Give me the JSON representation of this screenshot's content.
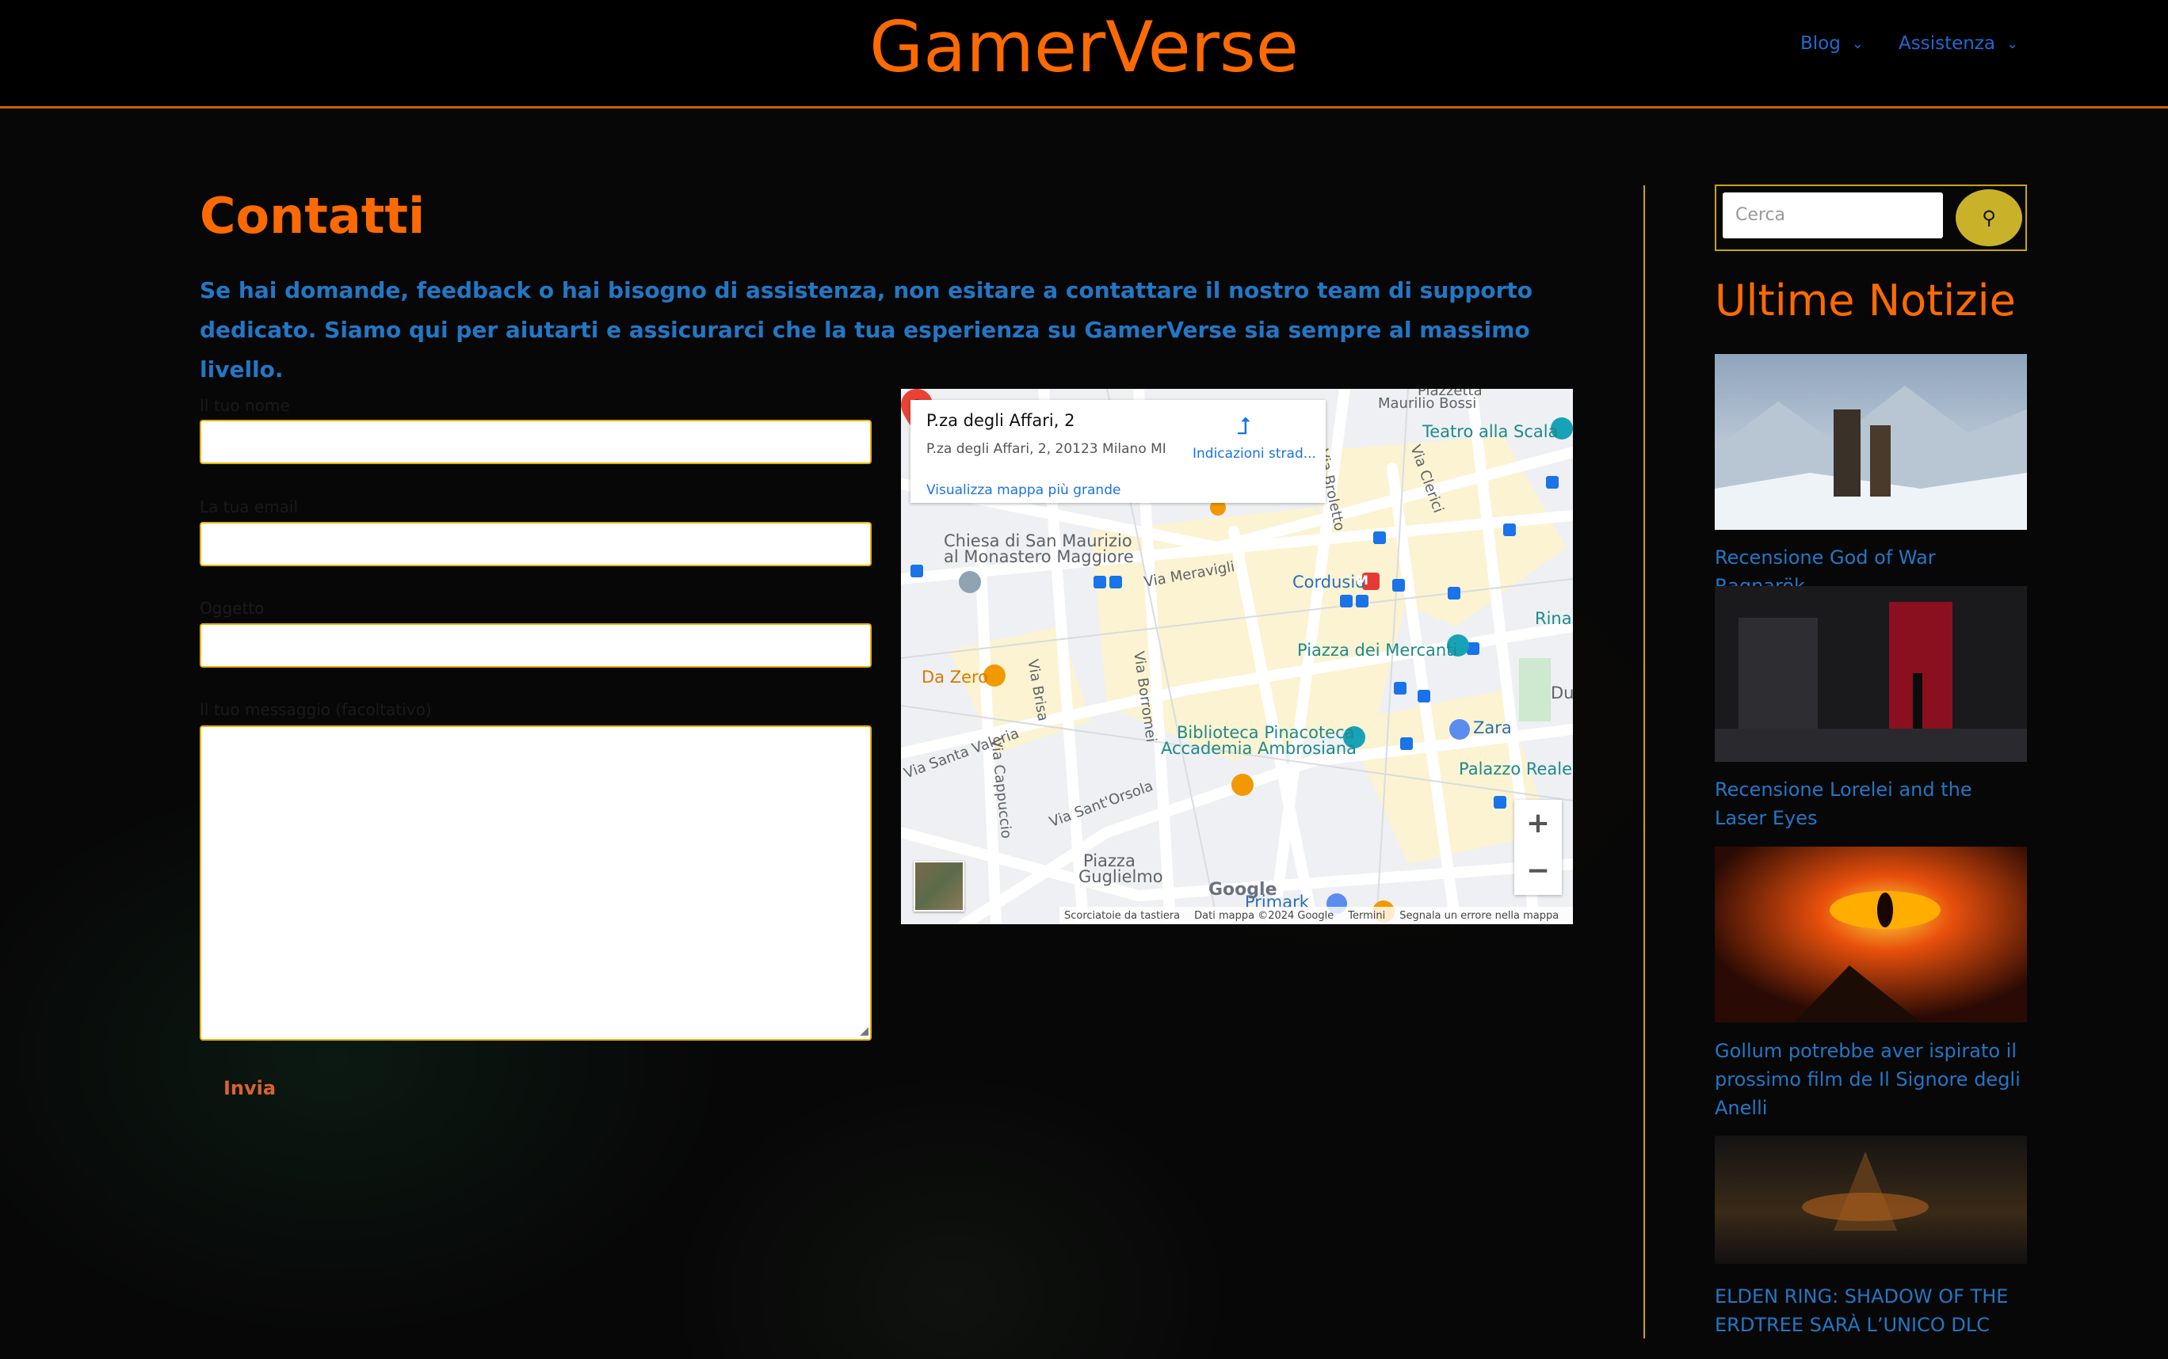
{
  "header": {
    "brand": "GamerVerse",
    "nav": [
      {
        "label": "Blog"
      },
      {
        "label": "Assistenza"
      }
    ]
  },
  "main": {
    "title": "Contatti",
    "intro": "Se hai domande, feedback o hai bisogno di assistenza, non esitare a contattare il nostro team di supporto dedicato. Siamo qui per aiutarti e assicurarci che la tua esperienza su GamerVerse sia sempre al massimo livello.",
    "form": {
      "name_label": "Il tuo nome",
      "email_label": "La tua email",
      "subject_label": "Oggetto",
      "message_label": "Il tuo messaggio (facoltativo)",
      "submit_label": "Invia"
    },
    "map": {
      "place_title": "P.za degli Affari, 2",
      "place_address": "P.za degli Affari, 2, 20123 Milano MI",
      "directions_label": "Indicazioni strad...",
      "larger_map_label": "Visualizza mappa più grande",
      "labels": {
        "piazzetta": "Piazzetta",
        "maurilio": "Maurilio Bossi",
        "teatro": "Teatro alla Scala",
        "chiesa1": "Chiesa di San Maurizio",
        "chiesa2": "al Monastero Maggiore",
        "via_meravigli": "Via Meravigli",
        "cordusio": "Cordusio",
        "rinas": "Rinas",
        "piazza_mercanti": "Piazza dei Mercanti",
        "da_zero": "Da Zero",
        "via_brisa": "Via Brisa",
        "via_borromei": "Via Borromei",
        "zara": "Zara",
        "biblioteca1": "Biblioteca Pinacoteca",
        "biblioteca2": "Accademia Ambrosiana",
        "santa_valeria": "Via Santa Valeria",
        "via_cappuccio": "Via Cappuccio",
        "palazzo_reale": "Palazzo Reale",
        "via_santorsola": "Via Sant'Orsola",
        "piazza_guglielmo1": "Piazza",
        "piazza_guglielmo2": "Guglielmo",
        "via_broletto": "Via Broletto",
        "via_clerici": "Via Clerici",
        "primark": "Primark",
        "du": "Du",
        "metro_m": "M"
      },
      "google_logo": "Google",
      "attribution": [
        "Scorciatoie da tastiera",
        "Dati mappa ©2024 Google",
        "Termini",
        "Segnala un errore nella mappa"
      ],
      "zoom_in": "+",
      "zoom_out": "−"
    }
  },
  "sidebar": {
    "search_placeholder": "Cerca",
    "title": "Ultime Notizie",
    "news": [
      {
        "title": "Recensione God of War Ragnarök"
      },
      {
        "title": "Recensione Lorelei and the Laser Eyes"
      },
      {
        "title": "Gollum potrebbe aver ispirato il prossimo film de Il Signore degli Anelli"
      },
      {
        "title": "ELDEN RING: SHADOW OF THE ERDTREE SARÀ L’UNICO DLC"
      }
    ]
  },
  "colors": {
    "brand_orange": "#ff6a00",
    "link_blue": "#2277c6",
    "gold_border": "#c9a400"
  }
}
